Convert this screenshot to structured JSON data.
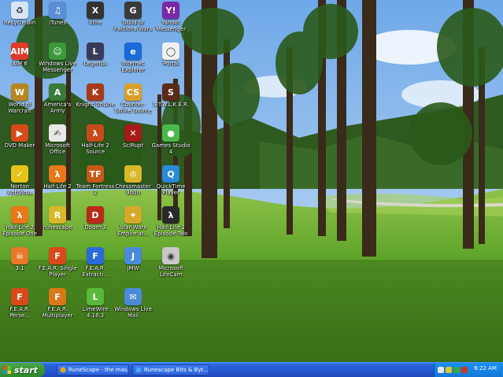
{
  "desktop": {
    "icons": [
      {
        "id": "recycle-bin",
        "label": "Recycle Bin",
        "glyph": "♻",
        "color": "#d7e6f2"
      },
      {
        "id": "itunes",
        "label": "iTunes",
        "glyph": "♫",
        "color": "#5a8fd8"
      },
      {
        "id": "xfire",
        "label": "Xfire",
        "glyph": "X",
        "color": "#333333"
      },
      {
        "id": "guild-wars",
        "label": "Guild of Factions Wars",
        "glyph": "G",
        "color": "#3a3a3a"
      },
      {
        "id": "yahoo-messenger",
        "label": "Yahoo! Messenger",
        "glyph": "Y!",
        "color": "#7a2aa8"
      },
      {
        "id": "aim",
        "label": "AIM 6",
        "glyph": "AIM",
        "color": "#e03a2a"
      },
      {
        "id": "windows-live-messenger",
        "label": "Windows Live Messenger",
        "glyph": "☺",
        "color": "#3a9a3a"
      },
      {
        "id": "legends",
        "label": "Legends",
        "glyph": "L",
        "color": "#3a3a5a"
      },
      {
        "id": "internet-explorer",
        "label": "Internet Explorer",
        "glyph": "e",
        "color": "#1a6ad8"
      },
      {
        "id": "portal",
        "label": "Portal",
        "glyph": "◯",
        "color": "#f0f0f0"
      },
      {
        "id": "world-of-warcraft",
        "label": "World of Warcraft",
        "glyph": "W",
        "color": "#b8861e"
      },
      {
        "id": "americas-army",
        "label": "America's Army",
        "glyph": "A",
        "color": "#3a7a3a"
      },
      {
        "id": "knight-online",
        "label": "Knight OnLine",
        "glyph": "K",
        "color": "#a83a1a"
      },
      {
        "id": "counter-strike",
        "label": "Counter-Strike Source",
        "glyph": "CS",
        "color": "#d8a02a"
      },
      {
        "id": "stalker",
        "label": "S.T.A.L.K.E.R.",
        "glyph": "S",
        "color": "#5a2a1a"
      },
      {
        "id": "dvd-maker",
        "label": "DVD Maker",
        "glyph": "▶",
        "color": "#d84a1a"
      },
      {
        "id": "microsoft-office",
        "label": "Microsoft Office",
        "glyph": "✍",
        "color": "#e8e8e8"
      },
      {
        "id": "half-life-source",
        "label": "Half-Life 2 Source",
        "glyph": "λ",
        "color": "#c84a1a"
      },
      {
        "id": "scrupt",
        "label": "SciRupt",
        "glyph": "✕",
        "color": "#a81a1a"
      },
      {
        "id": "games",
        "label": "Games Studio 4",
        "glyph": "●",
        "color": "#4ab84a"
      },
      {
        "id": "norton",
        "label": "Norton AntiVirus",
        "glyph": "✓",
        "color": "#e8c41a"
      },
      {
        "id": "half-life-2",
        "label": "Half-Life 2",
        "glyph": "λ",
        "color": "#e8781a"
      },
      {
        "id": "team-fortress-2",
        "label": "Team Fortress 2",
        "glyph": "TF",
        "color": "#c8581a"
      },
      {
        "id": "chessmaster",
        "label": "Chessmaster 9000",
        "glyph": "♔",
        "color": "#d8b82a"
      },
      {
        "id": "quicktime",
        "label": "QuickTime Player",
        "glyph": "Q",
        "color": "#2a8ad8"
      },
      {
        "id": "half-life-2-ep1",
        "label": "Half-Life 2 Episode One",
        "glyph": "λ",
        "color": "#e8781a"
      },
      {
        "id": "runescape",
        "label": "runescape",
        "glyph": "R",
        "color": "#d8b82a"
      },
      {
        "id": "doom-3",
        "label": "Doom 3",
        "glyph": "D",
        "color": "#b82a1a"
      },
      {
        "id": "star-wars",
        "label": "Star Wars Empire at...",
        "glyph": "✦",
        "color": "#d8a82a"
      },
      {
        "id": "half-life-2-ep2",
        "label": "Half-Life 2 Episode Two",
        "glyph": "λ",
        "color": "#2a2a2a"
      },
      {
        "id": "thirtyone",
        "label": "3.1",
        "glyph": "☠",
        "color": "#e8782a"
      },
      {
        "id": "fear-single",
        "label": "F.E.A.R. Single Player",
        "glyph": "F",
        "color": "#d84a1a"
      },
      {
        "id": "fear-extraction",
        "label": "F.E.A.R. Extracti...",
        "glyph": "F",
        "color": "#2a6ad8"
      },
      {
        "id": "jmw",
        "label": "JMW",
        "glyph": "J",
        "color": "#4a8ad8"
      },
      {
        "id": "microsoft-lifecam",
        "label": "Microsoft LifeCam",
        "glyph": "◉",
        "color": "#c8c8c8"
      },
      {
        "id": "fear-perseus",
        "label": "F.E.A.R. Perse...",
        "glyph": "F",
        "color": "#d84a1a"
      },
      {
        "id": "fear-multiplayer",
        "label": "F.E.A.R. Multiplayer",
        "glyph": "F",
        "color": "#d8781a"
      },
      {
        "id": "limewire",
        "label": "LimeWire 4.16.3",
        "glyph": "L",
        "color": "#5ab83a"
      },
      {
        "id": "windows-live-mail",
        "label": "Windows Live Mail",
        "glyph": "✉",
        "color": "#4a8ad8"
      }
    ]
  },
  "taskbar": {
    "start_label": "start",
    "tasks": [
      {
        "label": "RuneScape - the mas..."
      },
      {
        "label": "Runescape Bits & Byt..."
      }
    ],
    "clock": "6:22 AM"
  },
  "colors": {
    "taskbar": "#2458cf",
    "start": "#3b9a36",
    "tray": "#1a8ef0"
  }
}
